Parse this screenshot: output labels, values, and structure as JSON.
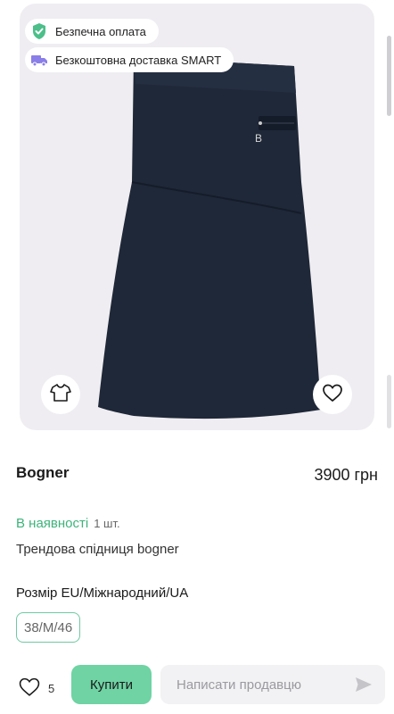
{
  "badges": {
    "secure_payment": "Безпечна оплата",
    "free_delivery": "Безкоштовна доставка SMART"
  },
  "product": {
    "brand": "Bogner",
    "price": "3900 грн",
    "availability": "В наявності",
    "quantity": "1 шт.",
    "description": "Трендова спідниця bogner",
    "size_label": "Розмір EU/Міжнародний/UA",
    "size_value": "38/M/46"
  },
  "actions": {
    "like_count": "5",
    "buy_label": "Купити",
    "message_placeholder": "Написати продавцю"
  },
  "icons": {
    "secure": "shield-check-icon",
    "delivery": "truck-icon",
    "size_chart": "tshirt-icon",
    "favorite": "heart-icon",
    "send": "send-icon"
  },
  "colors": {
    "accent_green": "#6fd3a4",
    "availability_green": "#3cb37a",
    "photo_background": "#efedf1",
    "skirt_navy": "#1f2838"
  }
}
